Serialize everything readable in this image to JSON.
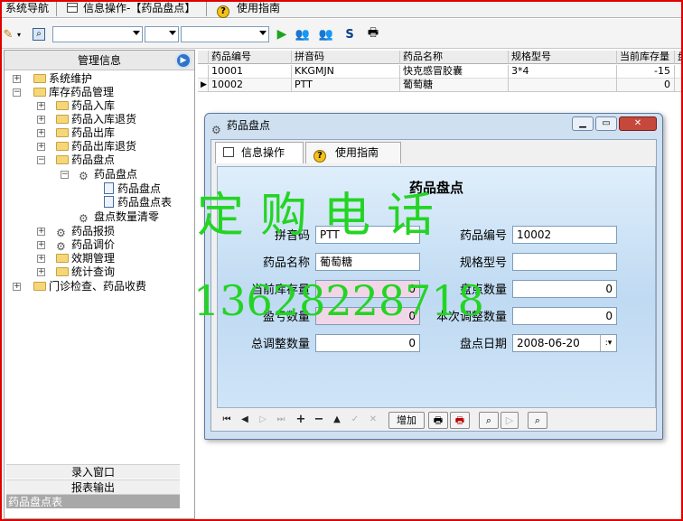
{
  "top_tabs": {
    "nav": "系统导航",
    "info": "信息操作-【药品盘点】",
    "guide": "使用指南"
  },
  "toolbar": {
    "combo1": "",
    "combo2": "",
    "combo3": ""
  },
  "left_panel": {
    "title": "管理信息",
    "tree": {
      "system": "系统维护",
      "inventory": "库存药品管理",
      "in": "药品入库",
      "in_return": "药品入库退货",
      "out": "药品出库",
      "out_return": "药品出库退货",
      "stocktake": "药品盘点",
      "stocktake_sub": "药品盘点",
      "stocktake_leaf": "药品盘点",
      "stocktake_table": "药品盘点表",
      "clear": "盘点数量清零",
      "loss": "药品报损",
      "price": "药品调价",
      "expiry": "效期管理",
      "stats": "统计查询",
      "clinic": "门诊检查、药品收费"
    },
    "buttons": {
      "entry": "录入窗口",
      "report": "报表输出"
    },
    "status": "药品盘点表"
  },
  "grid": {
    "columns": [
      "药品编号",
      "拼音码",
      "药品名称",
      "规格型号",
      "当前库存量",
      "盘"
    ],
    "rows": [
      {
        "code": "10001",
        "pinyin": "KKGMJN",
        "name": "快克感冒胶囊",
        "spec": "3*4",
        "stock": "-15"
      },
      {
        "code": "10002",
        "pinyin": "PTT",
        "name": "葡萄糖",
        "spec": "",
        "stock": "0"
      }
    ]
  },
  "dialog": {
    "title": "药品盘点",
    "tab_info": "信息操作",
    "tab_guide": "使用指南",
    "form_title": "药品盘点",
    "labels": {
      "pinyin": "拼音码",
      "code": "药品编号",
      "name": "药品名称",
      "spec": "规格型号",
      "stock": "当前库存量",
      "count": "盘点数量",
      "diff": "盈亏数量",
      "adjust": "本次调整数量",
      "total": "总调整数量",
      "date": "盘点日期"
    },
    "values": {
      "pinyin": "PTT",
      "code": "10002",
      "name": "葡萄糖",
      "spec": "",
      "stock": "0",
      "count": "0",
      "diff": "0",
      "adjust": "0",
      "total": "0",
      "date": "2008-06-20"
    },
    "add_button": "增加"
  },
  "watermark": {
    "line1": "定购电话",
    "line2": "13628228718"
  }
}
